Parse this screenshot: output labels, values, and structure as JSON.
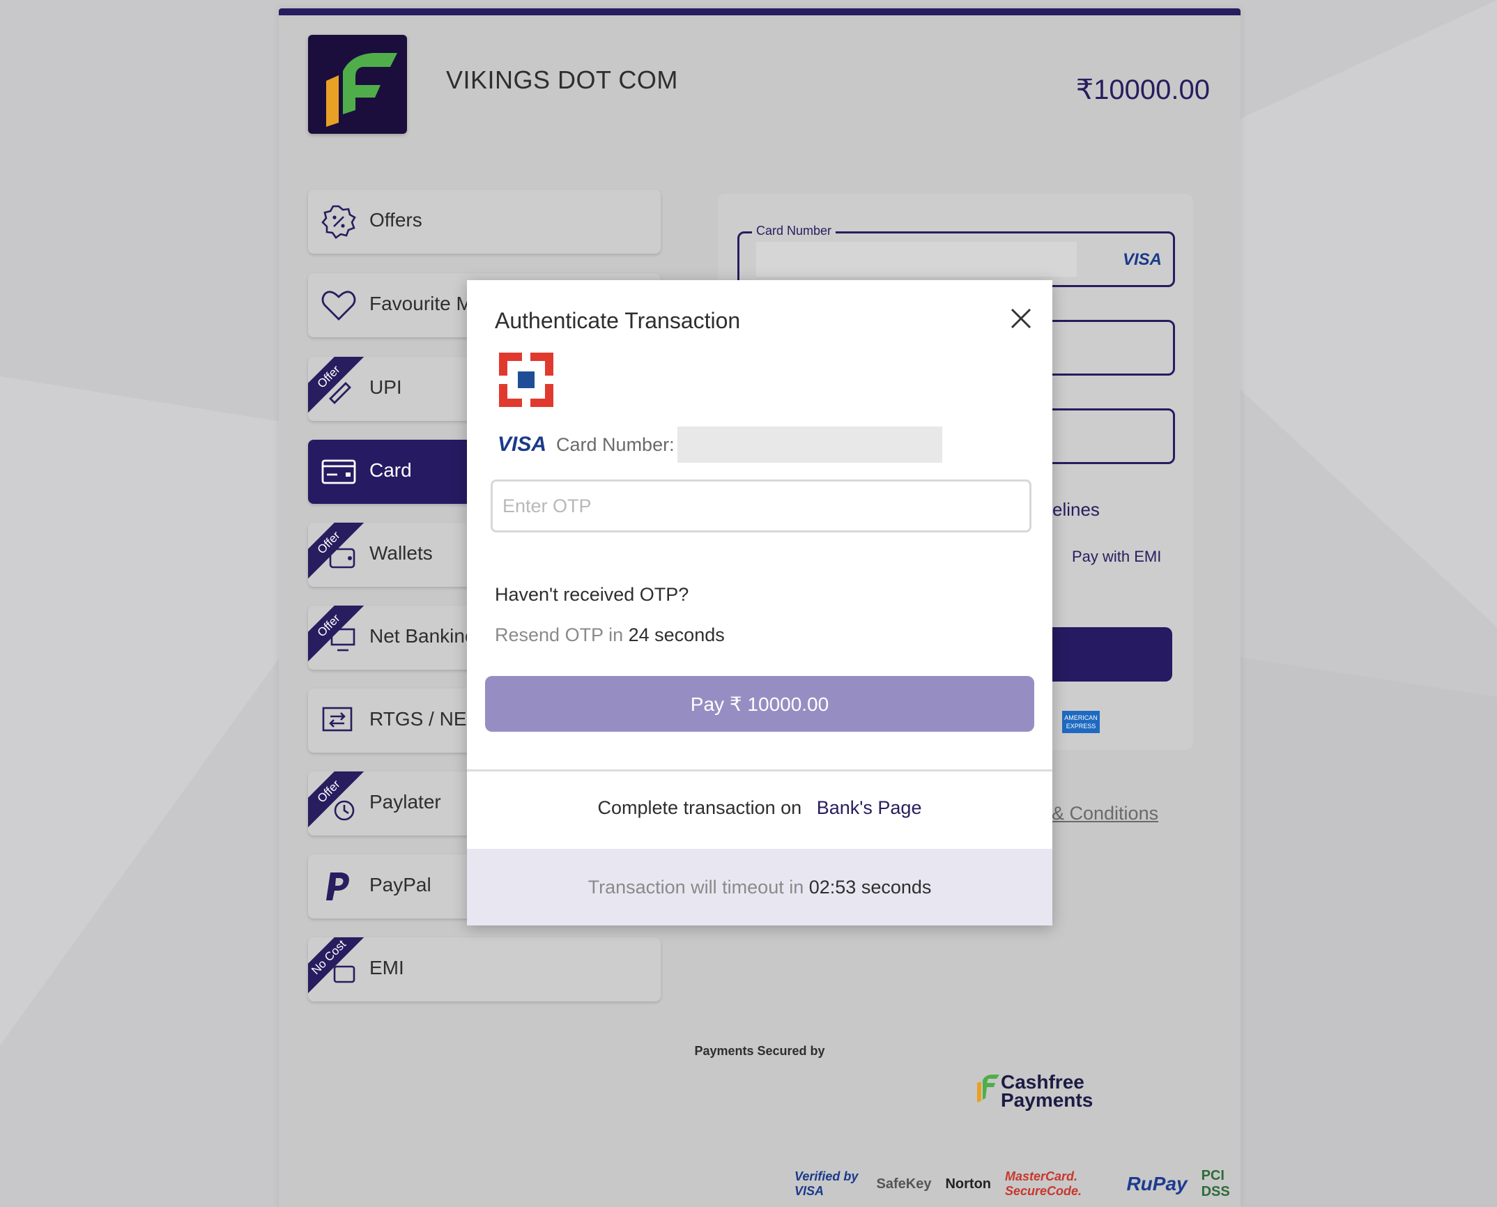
{
  "merchant": {
    "name": "VIKINGS DOT COM",
    "amount": "₹10000.00"
  },
  "methods": [
    {
      "label": "Offers",
      "icon": "percent-badge-icon",
      "ribbon": ""
    },
    {
      "label": "Favourite M",
      "icon": "heart-icon",
      "ribbon": ""
    },
    {
      "label": "UPI",
      "icon": "upi-icon",
      "ribbon": "Offer"
    },
    {
      "label": "Card",
      "icon": "card-icon",
      "ribbon": ""
    },
    {
      "label": "Wallets",
      "icon": "wallet-icon",
      "ribbon": "Offer"
    },
    {
      "label": "Net Bankinc",
      "icon": "netbanking-icon",
      "ribbon": "Offer"
    },
    {
      "label": "RTGS / NEF",
      "icon": "transfer-icon",
      "ribbon": ""
    },
    {
      "label": "Paylater",
      "icon": "clock-icon",
      "ribbon": "Offer"
    },
    {
      "label": "PayPal",
      "icon": "paypal-icon",
      "ribbon": ""
    },
    {
      "label": "EMI",
      "icon": "emi-icon",
      "ribbon": "No Cost"
    }
  ],
  "card_form": {
    "card_number_label": "Card Number",
    "card_brand": "VISA",
    "guidelines_fragment": "elines",
    "pay_with_emi": "Pay with EMI",
    "amex_label": "AMERICAN EXPRESS",
    "terms_fragment": "; & Conditions"
  },
  "footer": {
    "secured_by": "Payments Secured by",
    "brand_line1": "Cashfree",
    "brand_line2": "Payments",
    "badges": [
      "Verified by VISA",
      "SafeKey",
      "Norton",
      "MasterCard. SecureCode.",
      "RuPay",
      "PCI DSS"
    ]
  },
  "modal": {
    "title": "Authenticate Transaction",
    "card_brand": "VISA",
    "card_number_label": "Card Number:",
    "otp_placeholder": "Enter OTP",
    "no_otp": "Haven't received OTP?",
    "resend_prefix": "Resend OTP in",
    "resend_time": "24 seconds",
    "pay_label": "Pay ₹ 10000.00",
    "complete_prefix": "Complete transaction on",
    "bank_page_link": "Bank's Page",
    "timeout_prefix": "Transaction will timeout in",
    "timeout_value": "02:53 seconds"
  },
  "colors": {
    "brand": "#271d5f",
    "pay_button": "#968ec3",
    "timeout_bg": "#e8e7f1"
  }
}
